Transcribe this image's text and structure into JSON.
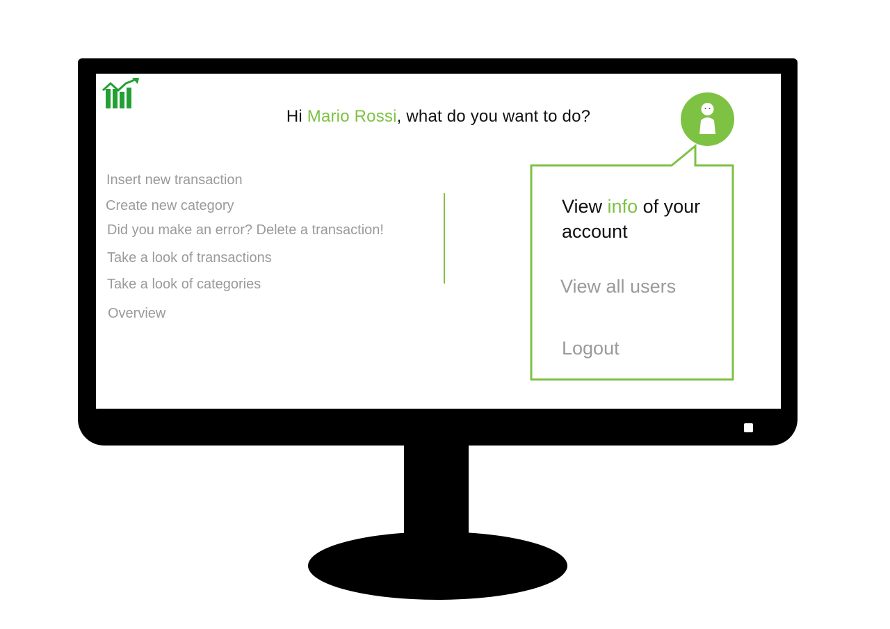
{
  "header": {
    "greeting_prefix": "Hi ",
    "user_name": "Mario Rossi",
    "greeting_suffix": ", what do you want to do?",
    "logo_icon": "bar-chart-trend-icon"
  },
  "menu": {
    "items": [
      {
        "label": "Insert new transaction"
      },
      {
        "label": "Create new category"
      },
      {
        "label": "Did you make an error? Delete a transaction!"
      },
      {
        "label": "Take a look of transactions"
      },
      {
        "label": "Take a look of categories"
      },
      {
        "label": "Overview"
      }
    ]
  },
  "account_menu": {
    "avatar_icon": "user-avatar-icon",
    "info_prefix": "View ",
    "info_accent": "info",
    "info_suffix": " of your",
    "info_line2": "account",
    "view_users": "View all users",
    "logout": "Logout"
  },
  "colors": {
    "accent": "#7dc242",
    "menu_text": "#9a9a9a",
    "primary_text": "#111111",
    "monitor": "#000000"
  }
}
